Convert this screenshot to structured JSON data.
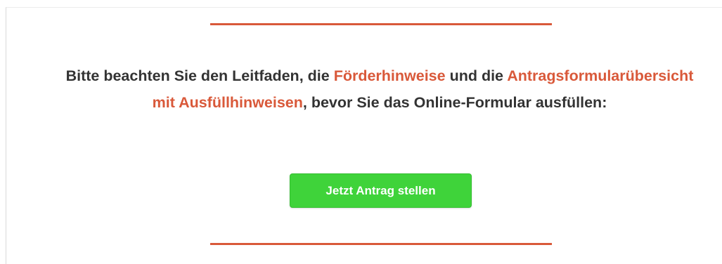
{
  "notice": {
    "part1": "Bitte beachten Sie den Leitfaden, die ",
    "link1": "Förderhinweise",
    "part2": " und die ",
    "link2": "Antragsformularübersicht mit Ausfüllhinweisen",
    "part3": ", bevor Sie das Online-Formular ausfüllen:"
  },
  "cta": {
    "label": "Jetzt Antrag stellen"
  },
  "colors": {
    "accent": "#d9593a",
    "button": "#3fd33a",
    "text": "#333333"
  }
}
